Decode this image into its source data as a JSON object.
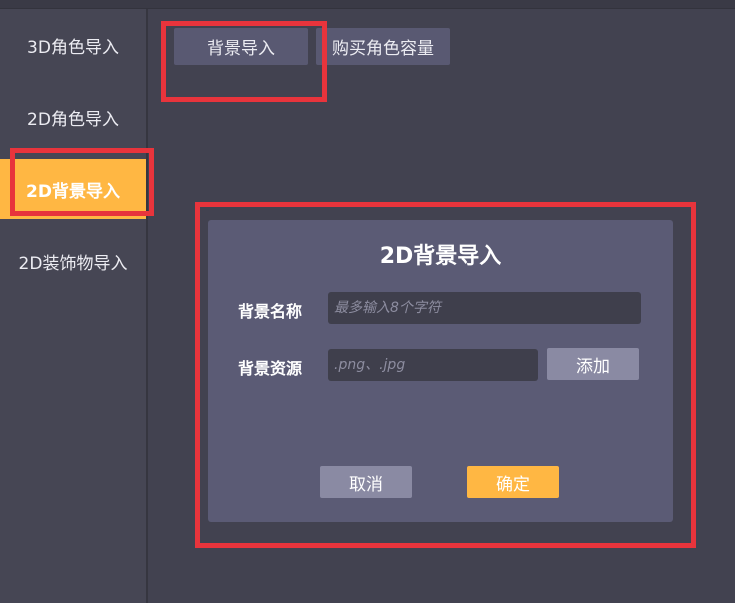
{
  "sidebar": {
    "items": [
      {
        "label": "3D角色导入",
        "active": false
      },
      {
        "label": "2D角色导入",
        "active": false
      },
      {
        "label": "2D背景导入",
        "active": true
      },
      {
        "label": "2D装饰物导入",
        "active": false
      }
    ]
  },
  "tabs": {
    "background_import": "背景导入",
    "buy_capacity": "购买角色容量"
  },
  "dialog": {
    "title": "2D背景导入",
    "name_label": "背景名称",
    "name_placeholder": "最多输入8个字符",
    "source_label": "背景资源",
    "source_placeholder": ".png、.jpg",
    "add_button": "添加",
    "cancel_button": "取消",
    "confirm_button": "确定"
  },
  "colors": {
    "accent": "#ffb743",
    "highlight": "#e8343c",
    "background": "#424250",
    "dialog": "#5b5b75"
  }
}
